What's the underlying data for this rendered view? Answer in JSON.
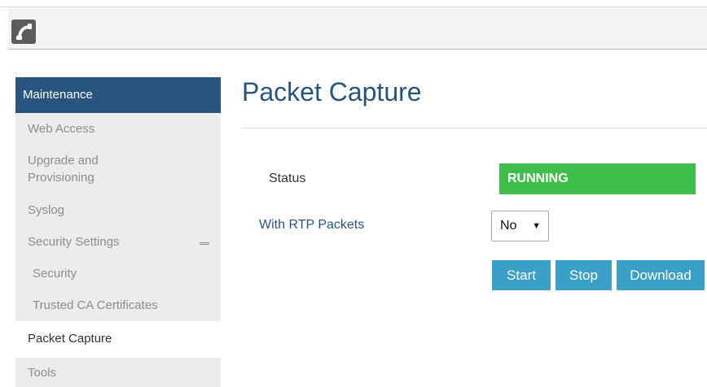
{
  "sidebar": {
    "header": "Maintenance",
    "items": [
      {
        "label": "Web Access"
      },
      {
        "label": "Upgrade and\nProvisioning"
      },
      {
        "label": "Syslog"
      },
      {
        "label": "Security Settings"
      },
      {
        "label": "Security"
      },
      {
        "label": "Trusted CA Certificates"
      },
      {
        "label": "Packet Capture"
      },
      {
        "label": "Tools"
      }
    ],
    "active": "Packet Capture"
  },
  "main": {
    "title": "Packet Capture",
    "status_label": "Status",
    "status_value": "RUNNING",
    "rtp_label": "With RTP Packets",
    "rtp_value": "No",
    "buttons": {
      "start": "Start",
      "stop": "Stop",
      "download": "Download"
    }
  },
  "colors": {
    "brand": "#27557f",
    "status_running": "#3ebe4a",
    "button": "#3aa0c6",
    "sidebar_bg": "#ececec"
  },
  "icons": {
    "logo": "phone-handset-icon",
    "collapse": "collapse-icon",
    "dropdown": "dropdown-arrow-icon"
  }
}
